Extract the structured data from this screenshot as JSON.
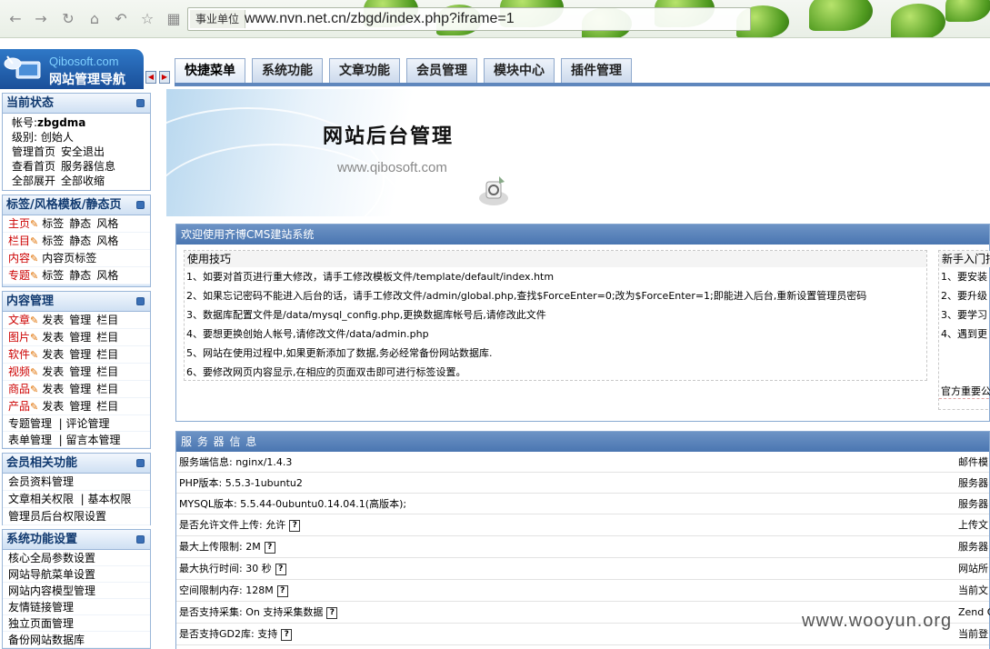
{
  "browser": {
    "zone_label": "事业单位",
    "url": "www.nvn.net.cn/zbgd/index.php?iframe=1",
    "nav_icons": [
      "back-icon",
      "forward-icon",
      "reload-icon",
      "home-icon",
      "undo-icon",
      "star-icon",
      "apps-icon"
    ]
  },
  "logo": {
    "site": "Qibosoft.com",
    "title": "网站管理导航"
  },
  "tabs": [
    "快捷菜单",
    "系统功能",
    "文章功能",
    "会员管理",
    "模块中心",
    "插件管理"
  ],
  "sidebar": {
    "status": {
      "title": "当前状态",
      "account_label": "帐号:",
      "account": "zbgdma",
      "level_label": "级别:",
      "level": "创始人",
      "links1": [
        "管理首页",
        "安全退出"
      ],
      "links2": [
        "查看首页",
        "服务器信息"
      ],
      "links3": [
        "全部展开",
        "全部收缩"
      ]
    },
    "tags": {
      "title": "标签/风格模板/静态页",
      "rows": [
        {
          "name": "主页",
          "actions": [
            "标签",
            "静态",
            "风格"
          ]
        },
        {
          "name": "栏目",
          "actions": [
            "标签",
            "静态",
            "风格"
          ]
        },
        {
          "name": "内容",
          "actions": [
            "内容页标签"
          ]
        },
        {
          "name": "专题",
          "actions": [
            "标签",
            "静态",
            "风格"
          ]
        }
      ]
    },
    "content": {
      "title": "内容管理",
      "rows": [
        {
          "name": "文章",
          "actions": [
            "发表",
            "管理",
            "栏目"
          ]
        },
        {
          "name": "图片",
          "actions": [
            "发表",
            "管理",
            "栏目"
          ]
        },
        {
          "name": "软件",
          "actions": [
            "发表",
            "管理",
            "栏目"
          ]
        },
        {
          "name": "视频",
          "actions": [
            "发表",
            "管理",
            "栏目"
          ]
        },
        {
          "name": "商品",
          "actions": [
            "发表",
            "管理",
            "栏目"
          ]
        },
        {
          "name": "产品",
          "actions": [
            "发表",
            "管理",
            "栏目"
          ]
        }
      ],
      "extra1": [
        "专题管理",
        "评论管理"
      ],
      "extra2": [
        "表单管理",
        "留言本管理"
      ]
    },
    "member": {
      "title": "会员相关功能",
      "row1": "会员资料管理",
      "row2": [
        "文章相关权限",
        "基本权限"
      ],
      "row3": "管理员后台权限设置"
    },
    "system": {
      "title": "系统功能设置",
      "rows": [
        "核心全局参数设置",
        "网站导航菜单设置",
        "网站内容模型管理",
        "友情链接管理",
        "独立页面管理",
        "备份网站数据库"
      ]
    }
  },
  "banner": {
    "title": "网站后台管理",
    "url": "www.qibosoft.com"
  },
  "welcome": {
    "title": "欢迎使用齐博CMS建站系统",
    "tips_title": "使用技巧",
    "tips": [
      "1、如要对首页进行重大修改，请手工修改模板文件/template/default/index.htm",
      "2、如果忘记密码不能进入后台的话，请手工修改文件/admin/global.php,查找$ForceEnter=0;改为$ForceEnter=1;即能进入后台,重新设置管理员密码",
      "3、数据库配置文件是/data/mysql_config.php,更换数据库帐号后,请修改此文件",
      "4、要想更换创始人帐号,请修改文件/data/admin.php",
      "5、网站在使用过程中,如果更新添加了数据,务必经常备份网站数据库.",
      "6、要修改网页内容显示,在相应的页面双击即可进行标签设置。"
    ],
    "newbie_title": "新手入门指",
    "newbie": [
      "1、要安装",
      "2、要升级",
      "3、要学习",
      "4、遇到更"
    ],
    "official": "官方重要公"
  },
  "server": {
    "title": "服 务 器 信 息",
    "rows": [
      {
        "left": "服务端信息: nginx/1.4.3",
        "right": "邮件模",
        "help": false
      },
      {
        "left": "PHP版本: 5.5.3-1ubuntu2",
        "right": "服务器",
        "help": false
      },
      {
        "left": "MYSQL版本: 5.5.44-0ubuntu0.14.04.1(高版本);",
        "right": "服务器",
        "help": false
      },
      {
        "left": "是否允许文件上传: 允许",
        "right": "上传文",
        "help": true
      },
      {
        "left": "最大上传限制: 2M",
        "right": "服务器",
        "help": true
      },
      {
        "left": "最大执行时间: 30 秒",
        "right": "网站所",
        "help": true
      },
      {
        "left": "空间限制内存: 128M",
        "right": "当前文",
        "help": true
      },
      {
        "left": "是否支持采集: On 支持采集数据",
        "right": "Zend O",
        "help": true
      },
      {
        "left": "是否支持GD2库: 支持",
        "right": "当前登",
        "help": true
      }
    ]
  },
  "watermark": "www.wooyun.org",
  "colors": {
    "accent": "#4a76b1",
    "red_link": "#cc0000",
    "section_bg": "#dbe9f8"
  }
}
